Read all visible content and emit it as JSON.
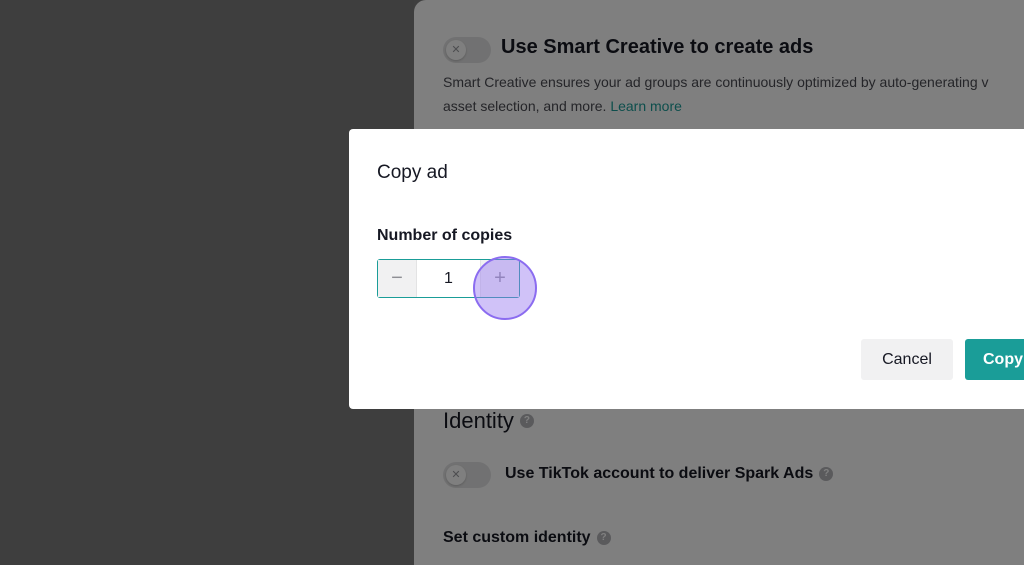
{
  "background": {
    "smart_creative": {
      "title": "Use Smart Creative to create ads",
      "description_line1": "Smart Creative ensures your ad groups are continuously optimized by auto-generating v",
      "description_line2": "asset selection, and more.",
      "learn_more": "Learn more",
      "toggle_state": "off"
    },
    "identity": {
      "title": "Identity",
      "spark_ads_label": "Use TikTok account to deliver Spark Ads",
      "spark_ads_toggle_state": "off",
      "custom_identity_label": "Set custom identity"
    }
  },
  "modal": {
    "title": "Copy ad",
    "field_label": "Number of copies",
    "stepper": {
      "value": "1",
      "minus": "−",
      "plus": "+"
    },
    "cancel_label": "Cancel",
    "copy_label": "Copy"
  },
  "icons": {
    "help": "?",
    "toggle_off": "✕"
  },
  "colors": {
    "accent": "#1a9d98",
    "overlay": "rgba(0,0,0,0.5)"
  }
}
